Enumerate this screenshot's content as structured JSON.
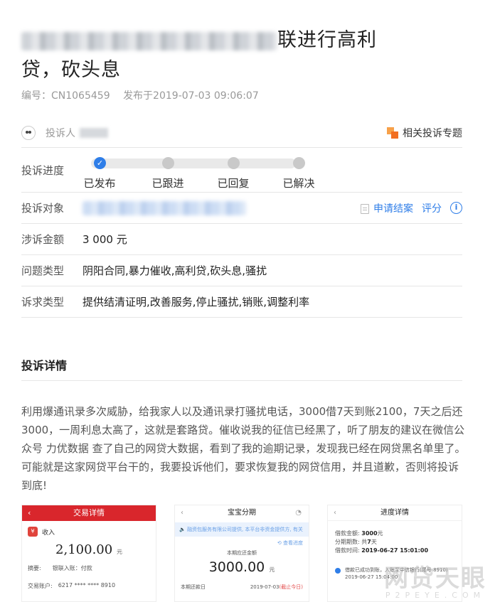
{
  "title": {
    "line1_visible": "联进行高利",
    "line2": "贷，砍头息"
  },
  "meta": {
    "number": "编号：CN1065459",
    "published": "发布于2019-07-03 09:06:07"
  },
  "complainant": {
    "label": "投诉人",
    "topic_link": "相关投诉专题"
  },
  "progress": {
    "label": "投诉进度",
    "steps": [
      "已发布",
      "已跟进",
      "已回复",
      "已解决"
    ],
    "completed_steps": 1
  },
  "target": {
    "label": "投诉对象",
    "apply_close": "申请结案",
    "rate": "评分",
    "info_icon": "i"
  },
  "amount": {
    "label": "涉诉金额",
    "value": "3 000 元"
  },
  "issue_type": {
    "label": "问题类型",
    "value": "阴阳合同,暴力催收,高利贷,砍头息,骚扰"
  },
  "demand_type": {
    "label": "诉求类型",
    "value": "提供结清证明,改善服务,停止骚扰,销账,调整利率"
  },
  "detail": {
    "title": "投诉详情",
    "text": "利用爆通讯录多次威胁，给我家人以及通讯录打骚扰电话，3000借7天到账2100，7天之后还3000，一周利息太高了，这就是套路贷。催收说我的征信已经黑了，听了朋友的建议在微信公众号 力优数据 查了自己的网贷大数据，看到了我的逾期记录，发现我已经在网贷黑名单里了。可能就是这家网贷平台干的，我要投诉他们，要求恢复我的网贷信用，并且道歉，否则将投诉到底!"
  },
  "screenshots": {
    "shot1": {
      "back": "‹",
      "title": "交易详情",
      "income": "收入",
      "income_icon": "¥",
      "amount": "2,100.00",
      "unit": "元",
      "summary_label": "摘要:",
      "summary_value": "银联入账：付款",
      "account_label": "交易账户:",
      "account_value": "6217 **** **** 8910"
    },
    "shot2": {
      "back": "‹",
      "title": "宝宝分期",
      "headset": "◔",
      "notice": "🔈 融资包服务有限公司提供, 本平台非资金提供方, 有关",
      "link": "⟲ 查看进度",
      "caption": "本期应还金额",
      "amount": "3000.00",
      "unit": "元",
      "due_label": "本期还款日",
      "due_date": "2019-07-03",
      "due_status": "(截止今日)"
    },
    "shot3": {
      "back": "‹",
      "title": "进度详情",
      "loan_amount_label": "借款金额:",
      "loan_amount": "3000",
      "loan_amount_unit": "元",
      "periods_label": "分期期数:",
      "periods_prefix": "共",
      "periods": "7",
      "periods_unit": "天",
      "loan_time_label": "借款时间:",
      "loan_time": "2019-06-27 15:01:00",
      "step_text": "借款已成功到账，入账至中信银行(尾号:8910)",
      "step_time": "2019-06-27 15:04:00"
    }
  },
  "watermark": {
    "main": "网贷天眼",
    "sub": "P2PEYE.COM"
  },
  "colors": {
    "accent": "#2f7ee8",
    "brand_red": "#d9262c",
    "topic_orange": "#f26f21"
  }
}
